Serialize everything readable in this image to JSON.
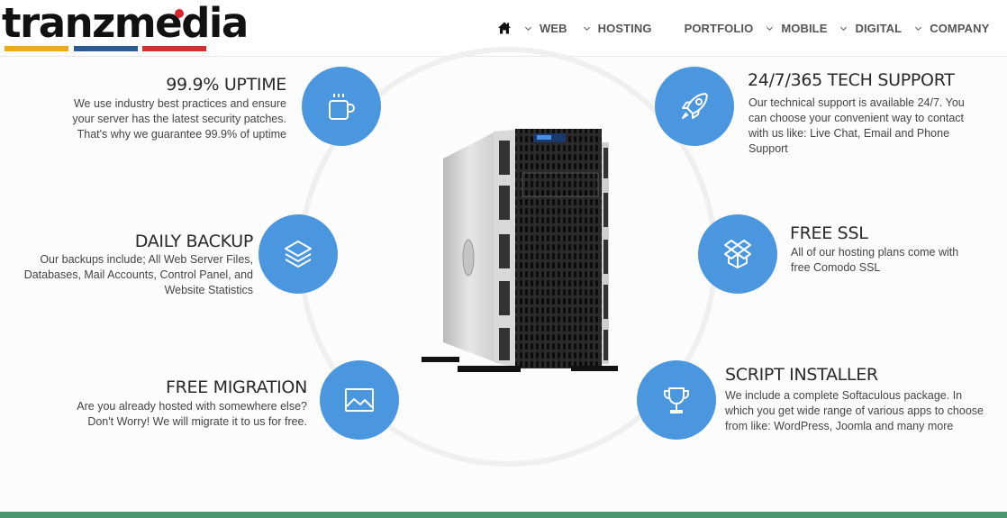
{
  "brand": {
    "name": "tranzmedia",
    "colors": {
      "dot": "#d9262a",
      "bar1": "#f0a91a",
      "bar2": "#2d5a95",
      "bar3": "#d42e2e",
      "accent": "#4a97df",
      "footer": "#4a956c"
    }
  },
  "nav": {
    "home_icon": "home-icon",
    "items": [
      {
        "label": "WEB",
        "has_dropdown": true
      },
      {
        "label": "HOSTING",
        "has_dropdown": true
      },
      {
        "label": "PORTFOLIO",
        "has_dropdown": false
      },
      {
        "label": "MOBILE",
        "has_dropdown": true
      },
      {
        "label": "DIGITAL",
        "has_dropdown": true
      },
      {
        "label": "COMPANY",
        "has_dropdown": true
      }
    ]
  },
  "features": {
    "uptime": {
      "title": "99.9% UPTIME",
      "description": "We use industry best practices and ensure\nyour server has the latest security patches.\nThat's why we guarantee 99.9% of uptime",
      "icon": "coffee-cup-icon"
    },
    "backup": {
      "title": "DAILY BACKUP",
      "description": "Our backups include; All Web Server Files,\nDatabases, Mail Accounts, Control Panel, and\nWebsite Statistics",
      "icon": "layers-icon"
    },
    "migration": {
      "title": "FREE MIGRATION",
      "description": "Are you already hosted with somewhere else?\nDon't Worry! We will migrate it to us for free.",
      "icon": "image-icon"
    },
    "support": {
      "title": "24/7/365 TECH SUPPORT",
      "description": "Our technical support is available 24/7. You\ncan choose your convenient way to contact\nwith us like: Live Chat,  Email and Phone\nSupport",
      "icon": "rocket-icon"
    },
    "ssl": {
      "title": "FREE SSL",
      "description": "All of our hosting plans come with\nfree Comodo SSL",
      "icon": "dropbox-box-icon"
    },
    "installer": {
      "title": "SCRIPT INSTALLER",
      "description": "We include a complete Softaculous package. In\nwhich you get wide range of various apps to choose\nfrom like: WordPress, Joomla and many more",
      "icon": "trophy-icon"
    }
  },
  "server_image": "tower-server-image"
}
